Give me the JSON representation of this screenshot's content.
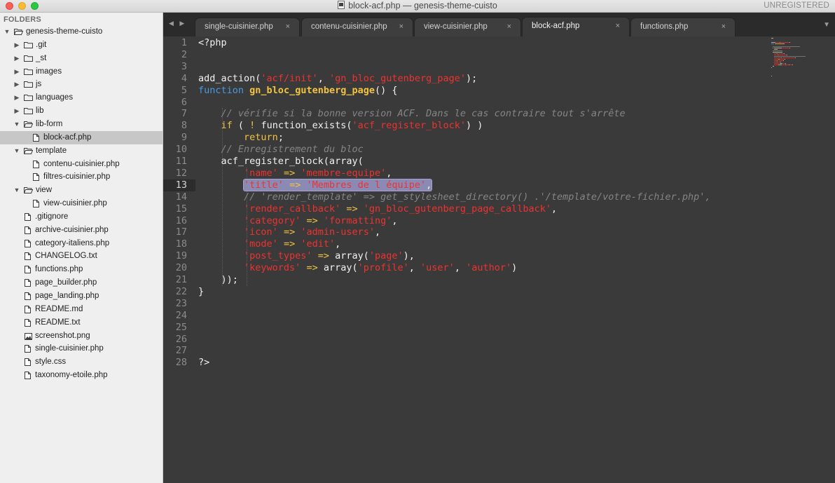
{
  "window": {
    "title": "block-acf.php — genesis-theme-cuisto",
    "registration_status": "UNREGISTERED"
  },
  "sidebar": {
    "header": "FOLDERS",
    "items": [
      {
        "label": "genesis-theme-cuisto",
        "type": "folder",
        "expanded": true,
        "depth": 0
      },
      {
        "label": ".git",
        "type": "folder",
        "expanded": false,
        "depth": 1
      },
      {
        "label": "_st",
        "type": "folder",
        "expanded": false,
        "depth": 1
      },
      {
        "label": "images",
        "type": "folder",
        "expanded": false,
        "depth": 1
      },
      {
        "label": "js",
        "type": "folder",
        "expanded": false,
        "depth": 1
      },
      {
        "label": "languages",
        "type": "folder",
        "expanded": false,
        "depth": 1
      },
      {
        "label": "lib",
        "type": "folder",
        "expanded": false,
        "depth": 1
      },
      {
        "label": "lib-form",
        "type": "folder",
        "expanded": true,
        "depth": 1
      },
      {
        "label": "block-acf.php",
        "type": "file",
        "depth": 2,
        "selected": true
      },
      {
        "label": "template",
        "type": "folder",
        "expanded": true,
        "depth": 1
      },
      {
        "label": "contenu-cuisinier.php",
        "type": "file",
        "depth": 2
      },
      {
        "label": "filtres-cuisinier.php",
        "type": "file",
        "depth": 2
      },
      {
        "label": "view",
        "type": "folder",
        "expanded": true,
        "depth": 1
      },
      {
        "label": "view-cuisinier.php",
        "type": "file",
        "depth": 2
      },
      {
        "label": ".gitignore",
        "type": "file",
        "depth": 1
      },
      {
        "label": "archive-cuisinier.php",
        "type": "file",
        "depth": 1
      },
      {
        "label": "category-italiens.php",
        "type": "file",
        "depth": 1
      },
      {
        "label": "CHANGELOG.txt",
        "type": "file",
        "depth": 1
      },
      {
        "label": "functions.php",
        "type": "file",
        "depth": 1
      },
      {
        "label": "page_builder.php",
        "type": "file",
        "depth": 1
      },
      {
        "label": "page_landing.php",
        "type": "file",
        "depth": 1
      },
      {
        "label": "README.md",
        "type": "file",
        "depth": 1
      },
      {
        "label": "README.txt",
        "type": "file",
        "depth": 1
      },
      {
        "label": "screenshot.png",
        "type": "image",
        "depth": 1
      },
      {
        "label": "single-cuisinier.php",
        "type": "file",
        "depth": 1
      },
      {
        "label": "style.css",
        "type": "file",
        "depth": 1
      },
      {
        "label": "taxonomy-etoile.php",
        "type": "file",
        "depth": 1
      }
    ]
  },
  "tabs": [
    {
      "label": "single-cuisinier.php",
      "close": "×",
      "active": false
    },
    {
      "label": "contenu-cuisinier.php",
      "close": "×",
      "active": false
    },
    {
      "label": "view-cuisinier.php",
      "close": "×",
      "active": false
    },
    {
      "label": "block-acf.php",
      "close": "×",
      "active": true
    },
    {
      "label": "functions.php",
      "close": "×",
      "active": false
    }
  ],
  "editor": {
    "current_line": 13,
    "lines": [
      {
        "n": "1",
        "tokens": [
          [
            "plain",
            "<?php"
          ]
        ]
      },
      {
        "n": "2",
        "tokens": []
      },
      {
        "n": "3",
        "tokens": []
      },
      {
        "n": "4",
        "tokens": [
          [
            "plain",
            "add_action("
          ],
          [
            "string",
            "'acf/init'"
          ],
          [
            "plain",
            ", "
          ],
          [
            "string",
            "'gn_bloc_gutenberg_page'"
          ],
          [
            "plain",
            ");"
          ]
        ]
      },
      {
        "n": "5",
        "tokens": [
          [
            "keyword",
            "function"
          ],
          [
            "plain",
            " "
          ],
          [
            "funcname",
            "gn_bloc_gutenberg_page"
          ],
          [
            "plain",
            "() {"
          ]
        ]
      },
      {
        "n": "6",
        "tokens": []
      },
      {
        "n": "7",
        "tokens": [
          [
            "plain",
            "    "
          ],
          [
            "comment",
            "// vérifie si la bonne version ACF. Dans le cas contraire tout s'arrête"
          ]
        ]
      },
      {
        "n": "8",
        "tokens": [
          [
            "plain",
            "    "
          ],
          [
            "control",
            "if"
          ],
          [
            "plain",
            " ( "
          ],
          [
            "op",
            "!"
          ],
          [
            "plain",
            " function_exists("
          ],
          [
            "string",
            "'acf_register_block'"
          ],
          [
            "plain",
            ") )"
          ]
        ]
      },
      {
        "n": "9",
        "tokens": [
          [
            "plain",
            "        "
          ],
          [
            "control",
            "return"
          ],
          [
            "plain",
            ";"
          ]
        ]
      },
      {
        "n": "10",
        "tokens": [
          [
            "plain",
            "    "
          ],
          [
            "comment",
            "// Enregistrement du bloc"
          ]
        ]
      },
      {
        "n": "11",
        "tokens": [
          [
            "plain",
            "    acf_register_block(array("
          ]
        ]
      },
      {
        "n": "12",
        "tokens": [
          [
            "plain",
            "        "
          ],
          [
            "string",
            "'name'"
          ],
          [
            "plain",
            " "
          ],
          [
            "op",
            "=>"
          ],
          [
            "plain",
            " "
          ],
          [
            "string",
            "'membre-equipe'"
          ],
          [
            "plain",
            ","
          ]
        ]
      },
      {
        "n": "13",
        "selected": true,
        "tokens": [
          [
            "plain",
            "        "
          ],
          [
            "string",
            "'title'"
          ],
          [
            "plain",
            " "
          ],
          [
            "op",
            "=>"
          ],
          [
            "plain",
            " "
          ],
          [
            "string",
            "'Membres de l équipe'"
          ],
          [
            "plain",
            ","
          ]
        ]
      },
      {
        "n": "14",
        "tokens": [
          [
            "plain",
            "        "
          ],
          [
            "comment",
            "// 'render_template' => get_stylesheet_directory() .'/template/votre-fichier.php',"
          ]
        ]
      },
      {
        "n": "15",
        "tokens": [
          [
            "plain",
            "        "
          ],
          [
            "string",
            "'render_callback'"
          ],
          [
            "plain",
            " "
          ],
          [
            "op",
            "=>"
          ],
          [
            "plain",
            " "
          ],
          [
            "string",
            "'gn_bloc_gutenberg_page_callback'"
          ],
          [
            "plain",
            ","
          ]
        ]
      },
      {
        "n": "16",
        "tokens": [
          [
            "plain",
            "        "
          ],
          [
            "string",
            "'category'"
          ],
          [
            "plain",
            " "
          ],
          [
            "op",
            "=>"
          ],
          [
            "plain",
            " "
          ],
          [
            "string",
            "'formatting'"
          ],
          [
            "plain",
            ","
          ]
        ]
      },
      {
        "n": "17",
        "tokens": [
          [
            "plain",
            "        "
          ],
          [
            "string",
            "'icon'"
          ],
          [
            "plain",
            " "
          ],
          [
            "op",
            "=>"
          ],
          [
            "plain",
            " "
          ],
          [
            "string",
            "'admin-users'"
          ],
          [
            "plain",
            ","
          ]
        ]
      },
      {
        "n": "18",
        "tokens": [
          [
            "plain",
            "        "
          ],
          [
            "string",
            "'mode'"
          ],
          [
            "plain",
            " "
          ],
          [
            "op",
            "=>"
          ],
          [
            "plain",
            " "
          ],
          [
            "string",
            "'edit'"
          ],
          [
            "plain",
            ","
          ]
        ]
      },
      {
        "n": "19",
        "tokens": [
          [
            "plain",
            "        "
          ],
          [
            "string",
            "'post_types'"
          ],
          [
            "plain",
            " "
          ],
          [
            "op",
            "=>"
          ],
          [
            "plain",
            " array("
          ],
          [
            "string",
            "'page'"
          ],
          [
            "plain",
            "),"
          ]
        ]
      },
      {
        "n": "20",
        "tokens": [
          [
            "plain",
            "        "
          ],
          [
            "string",
            "'keywords'"
          ],
          [
            "plain",
            " "
          ],
          [
            "op",
            "=>"
          ],
          [
            "plain",
            " array("
          ],
          [
            "string",
            "'profile'"
          ],
          [
            "plain",
            ", "
          ],
          [
            "string",
            "'user'"
          ],
          [
            "plain",
            ", "
          ],
          [
            "string",
            "'author'"
          ],
          [
            "plain",
            ")"
          ]
        ]
      },
      {
        "n": "21",
        "tokens": [
          [
            "plain",
            "    ));"
          ]
        ]
      },
      {
        "n": "22",
        "tokens": [
          [
            "plain",
            "}"
          ]
        ]
      },
      {
        "n": "23",
        "tokens": []
      },
      {
        "n": "24",
        "tokens": []
      },
      {
        "n": "25",
        "tokens": []
      },
      {
        "n": "26",
        "tokens": []
      },
      {
        "n": "27",
        "tokens": []
      },
      {
        "n": "28",
        "tokens": [
          [
            "plain",
            "?>"
          ]
        ]
      }
    ]
  },
  "colors": {
    "string": "#ee3230",
    "keyword": "#4a98e4",
    "function_name": "#f2c33f",
    "comment": "#858585",
    "selection": "#8a8ab4"
  },
  "icons": {
    "nav": "nav-arrows-icon",
    "tab_overflow": "chevron-down-icon",
    "folder": "folder-icon",
    "file": "file-icon",
    "image": "image-file-icon"
  }
}
